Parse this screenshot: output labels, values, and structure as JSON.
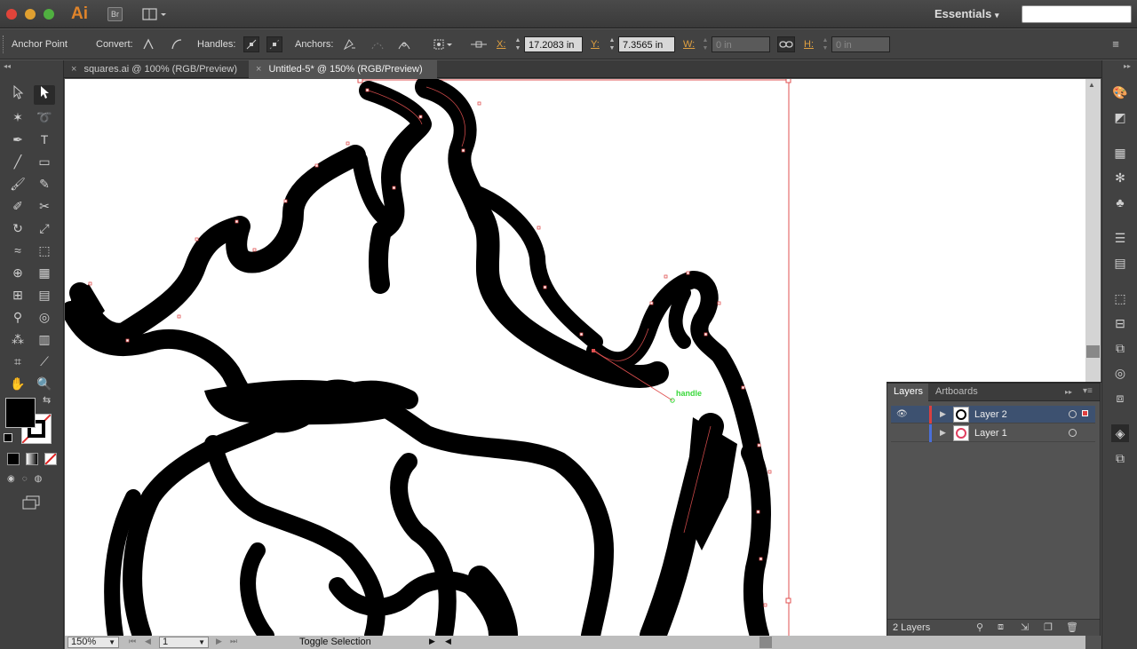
{
  "app": {
    "logo": "Ai",
    "bridge_label": "Br",
    "workspace": "Essentials",
    "workspace_arrow": "▾"
  },
  "control": {
    "tool_name": "Anchor Point",
    "convert_label": "Convert:",
    "handles_label": "Handles:",
    "anchors_label": "Anchors:",
    "x_label": "X:",
    "x_value": "17.2083 in",
    "y_label": "Y:",
    "y_value": "7.3565 in",
    "w_label": "W:",
    "w_value": "0 in",
    "h_label": "H:",
    "h_value": "0 in"
  },
  "tabs": [
    {
      "label": "squares.ai @ 100% (RGB/Preview)",
      "close": "×"
    },
    {
      "label": "Untitled-5* @ 150% (RGB/Preview)",
      "close": "×"
    }
  ],
  "canvas": {
    "annotation": "handle"
  },
  "layers_panel": {
    "tab_layers": "Layers",
    "tab_artboards": "Artboards",
    "layers": [
      {
        "name": "Layer 2",
        "color": "#d94040",
        "selected": true
      },
      {
        "name": "Layer 1",
        "color": "#4a6fd9",
        "selected": false
      }
    ],
    "footer_count": "2 Layers"
  },
  "status": {
    "zoom": "150%",
    "artboard": "1",
    "toggle": "Toggle Selection"
  },
  "colors": {
    "accent": "#e0842a",
    "selection": "#e05050",
    "annotation": "#39d83a"
  }
}
